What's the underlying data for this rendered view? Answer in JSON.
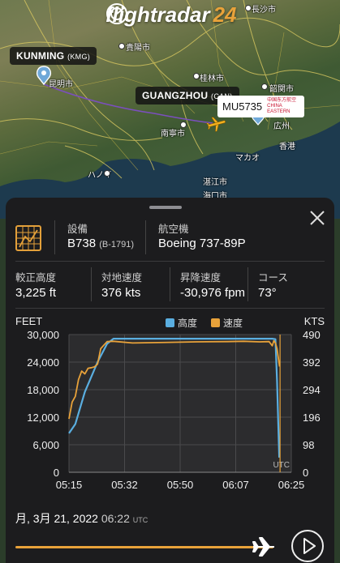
{
  "map": {
    "logo_text": "flightradar",
    "logo_num": "24",
    "origin": {
      "code": "KUNMING",
      "iata": "(KMG)"
    },
    "destination": {
      "code": "GUANGZHOU",
      "iata": "(CAN)"
    },
    "flight": {
      "number": "MU5735",
      "airline": "中国东方航空 CHINA EASTERN"
    },
    "cities": {
      "changsha": "長沙市",
      "guiyang": "貴陽市",
      "kunming": "昆明市",
      "guilin": "桂林市",
      "shaoguan": "韶関市",
      "nanning": "南寧市",
      "guangzhou": "広州",
      "macau": "マカオ",
      "hongkong": "香港",
      "zhanjiang": "湛江市",
      "haikou": "海口市",
      "hanoi": "ハノイ"
    }
  },
  "panel": {
    "equipment_label": "設備",
    "equipment_value": "B738",
    "registration": "(B-1791)",
    "aircraft_label": "航空機",
    "aircraft_value": "Boeing 737-89P",
    "alt_label": "較正高度",
    "alt_value": "3,225 ft",
    "gs_label": "対地速度",
    "gs_value": "376 kts",
    "vs_label": "昇降速度",
    "vs_value": "-30,976 fpm",
    "course_label": "コース",
    "course_value": "73°",
    "date_main": "月, 3月 21, 2022",
    "date_time": "06:22",
    "date_tz": "UTC"
  },
  "chart_data": {
    "type": "line",
    "left_axis_label": "FEET",
    "right_axis_label": "KTS",
    "y_left_ticks": [
      "30,000",
      "24,000",
      "18,000",
      "12,000",
      "6,000",
      "0"
    ],
    "y_right_ticks": [
      "490",
      "392",
      "294",
      "196",
      "98",
      "0"
    ],
    "x_ticks": [
      "05:15",
      "05:32",
      "05:50",
      "06:07",
      "06:25"
    ],
    "utc_label": "UTC",
    "ylim_left": [
      0,
      30000
    ],
    "ylim_right": [
      0,
      490
    ],
    "xlim_minutes": [
      0,
      70
    ],
    "series": [
      {
        "name": "高度",
        "color": "#5aaee0",
        "x": [
          0,
          2,
          5,
          9,
          12,
          14,
          20,
          40,
          55,
          63,
          64,
          65,
          65.5,
          66.2
        ],
        "y": [
          8500,
          10500,
          17500,
          24000,
          28000,
          29100,
          29100,
          29100,
          29100,
          29100,
          29100,
          29000,
          20000,
          3200
        ]
      },
      {
        "name": "速度",
        "color": "#e8a23a",
        "x": [
          0,
          1,
          2,
          3,
          4,
          5,
          6,
          7,
          8,
          9,
          10,
          12,
          14,
          20,
          30,
          40,
          50,
          55,
          60,
          63,
          64,
          64.5,
          65,
          65.5,
          66,
          66.3
        ],
        "y": [
          190,
          250,
          270,
          330,
          360,
          350,
          370,
          372,
          375,
          385,
          440,
          465,
          466,
          460,
          462,
          464,
          465,
          466,
          464,
          465,
          450,
          468,
          460,
          440,
          400,
          376
        ]
      }
    ]
  }
}
